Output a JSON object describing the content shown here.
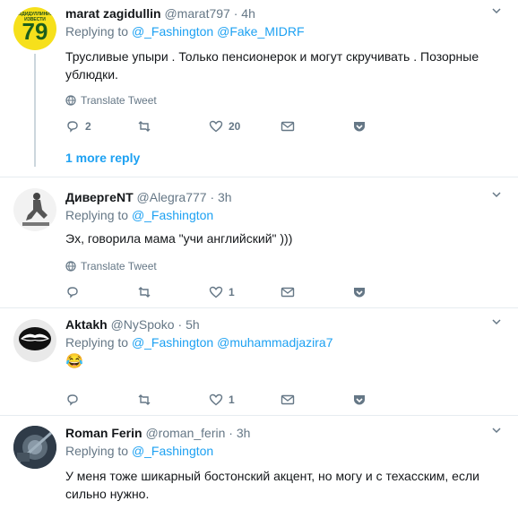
{
  "tweets": [
    {
      "name": "marat zagidullin",
      "handle": "@marat797",
      "dot": "·",
      "time": "4h",
      "replying_prefix": "Replying to",
      "mentions": [
        "@_Fashington",
        "@Fake_MIDRF"
      ],
      "text": "Трусливые упыри . Только пенсионерок и могут скручивать . Позорные ублюдки.",
      "translate": "Translate Tweet",
      "reply_count": "2",
      "retweet_count": "",
      "like_count": "20"
    },
    {
      "name": "ДивергеNT",
      "handle": "@Alegra777",
      "dot": "·",
      "time": "3h",
      "replying_prefix": "Replying to",
      "mentions": [
        "@_Fashington"
      ],
      "text": "Эх, говорила мама \"учи английский\" )))",
      "translate": "Translate Tweet",
      "reply_count": "",
      "retweet_count": "",
      "like_count": "1"
    },
    {
      "name": "Aktakh",
      "handle": "@NySpoko",
      "dot": "·",
      "time": "5h",
      "replying_prefix": "Replying to",
      "mentions": [
        "@_Fashington",
        "@muhammadjazira7"
      ],
      "text": "😂",
      "reply_count": "",
      "retweet_count": "",
      "like_count": "1"
    },
    {
      "name": "Roman Ferin",
      "handle": "@roman_ferin",
      "dot": "·",
      "time": "3h",
      "replying_prefix": "Replying to",
      "mentions": [
        "@_Fashington"
      ],
      "text": "У меня тоже шикарный бостонский акцент, но могу и с техасским, если сильно нужно."
    }
  ],
  "avatar1_text": "79",
  "avatar1_band": "ГАЗДИДУЛЛИНИ.ВСЕ ИЗВЕСТИ",
  "more_reply": "1 more reply",
  "colors": {
    "link": "#1da1f2",
    "muted": "#657786",
    "border": "#e6ecf0",
    "avatar1": "#f6e01b"
  }
}
